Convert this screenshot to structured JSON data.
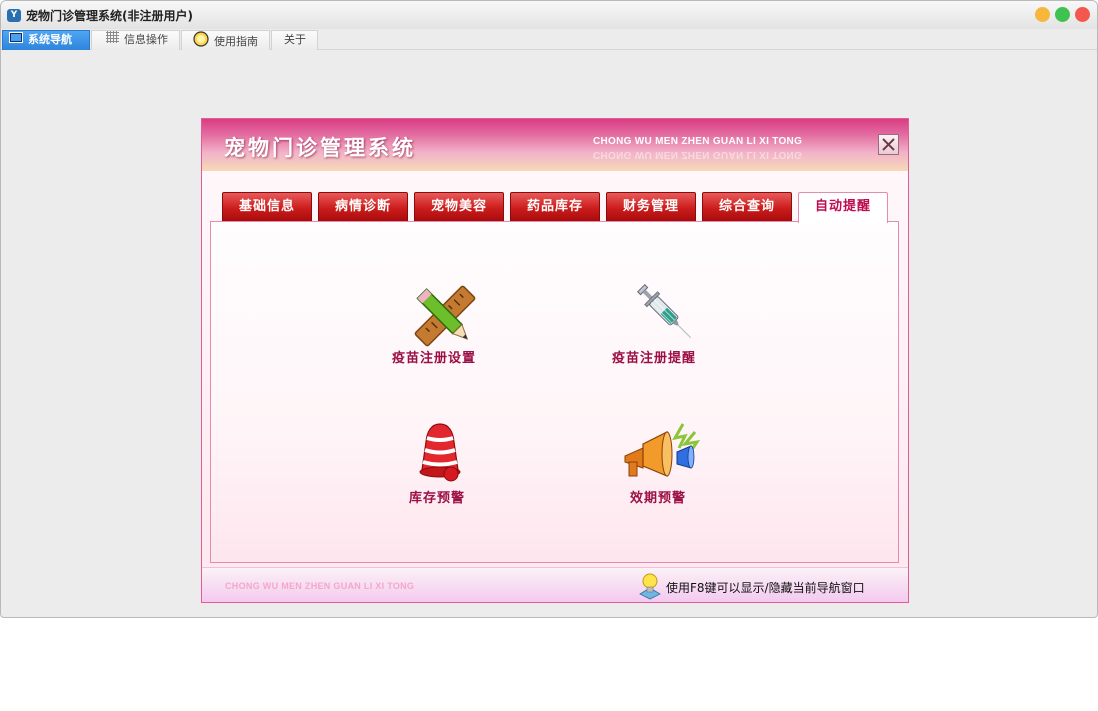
{
  "window": {
    "title": "宠物门诊管理系统(非注册用户)",
    "icon": "app-logo-icon",
    "controls": [
      "minimize",
      "maximize",
      "close"
    ],
    "colors": {
      "minimize": "#f6b73c",
      "maximize": "#3fc250",
      "close": "#f4574e"
    }
  },
  "app_tabs": [
    {
      "label": "系统导航",
      "icon": "monitor-icon",
      "active": true
    },
    {
      "label": "信息操作",
      "icon": "grid-icon",
      "active": false
    },
    {
      "label": "使用指南",
      "icon": "compass-icon",
      "active": false
    },
    {
      "label": "关于",
      "icon": "",
      "active": false
    }
  ],
  "nav": {
    "title": "宠物门诊管理系统",
    "pinyin": "CHONG WU MEN ZHEN GUAN LI XI TONG",
    "close_icon": "close-icon",
    "tabs": [
      {
        "label": "基础信息",
        "active": false
      },
      {
        "label": "病情诊断",
        "active": false
      },
      {
        "label": "宠物美容",
        "active": false
      },
      {
        "label": "药品库存",
        "active": false
      },
      {
        "label": "财务管理",
        "active": false
      },
      {
        "label": "综合查询",
        "active": false
      },
      {
        "label": "自动提醒",
        "active": true
      }
    ],
    "features": [
      {
        "label": "疫苗注册设置",
        "icon": "pencil-ruler-icon"
      },
      {
        "label": "疫苗注册提醒",
        "icon": "syringe-icon"
      },
      {
        "label": "库存预警",
        "icon": "alarm-bell-icon"
      },
      {
        "label": "效期预警",
        "icon": "megaphone-icon"
      }
    ],
    "footer": {
      "pinyin": "CHONG WU MEN ZHEN  GUAN LI XI TONG",
      "hint": "使用F8键可以显示/隐藏当前导航窗口",
      "hint_icon": "lightbulb-icon"
    },
    "accent_color": "#d93d82",
    "tab_color": "#cc1c1c",
    "label_color": "#9c0f45"
  }
}
